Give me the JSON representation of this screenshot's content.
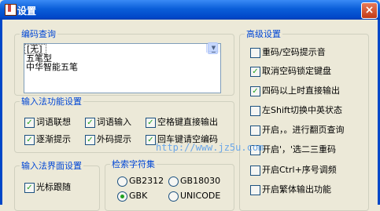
{
  "window": {
    "title": "设置",
    "close_symbol": "×"
  },
  "encoding_query": {
    "legend": "编码查询",
    "items": [
      "[无]",
      "五笔型",
      "中华智能五笔"
    ],
    "selected": "[无]"
  },
  "ime_functions": {
    "legend": "输入法功能设置",
    "options": [
      {
        "label": "词语联想",
        "checked": true
      },
      {
        "label": "词语输入",
        "checked": true
      },
      {
        "label": "空格键直接输出",
        "checked": true
      },
      {
        "label": "逐渐提示",
        "checked": true
      },
      {
        "label": "外码提示",
        "checked": true
      },
      {
        "label": "回车键请空编码",
        "checked": true
      }
    ]
  },
  "ime_ui": {
    "legend": "输入法界面设置",
    "options": [
      {
        "label": "光标跟随",
        "checked": true
      }
    ]
  },
  "charset": {
    "legend": "检索字符集",
    "options": [
      {
        "label": "GB2312",
        "selected": false
      },
      {
        "label": "GB18030",
        "selected": false
      },
      {
        "label": "GBK",
        "selected": true
      },
      {
        "label": "UNICODE",
        "selected": false
      }
    ]
  },
  "advanced": {
    "legend": "高级设置",
    "options": [
      {
        "label": "重码/空码提示音",
        "checked": false
      },
      {
        "label": "取消空码锁定键盘",
        "checked": true
      },
      {
        "label": "四码以上时直接输出",
        "checked": true
      },
      {
        "label": "左Shift切换中英状态",
        "checked": false
      },
      {
        "label": "开启，。进行翻页查询",
        "checked": false
      },
      {
        "label": "开启'，'选二三重码",
        "checked": false
      },
      {
        "label": "开启Ctrl+序号调频",
        "checked": false
      },
      {
        "label": "开启繁体输出功能",
        "checked": false
      }
    ]
  },
  "watermark": {
    "text": "http://www.jz5u.com"
  },
  "colors": {
    "title_bar": "#0a5ed9",
    "legend_text": "#0046d5",
    "window_bg": "#ece9d8",
    "check_mark": "#21a121"
  }
}
